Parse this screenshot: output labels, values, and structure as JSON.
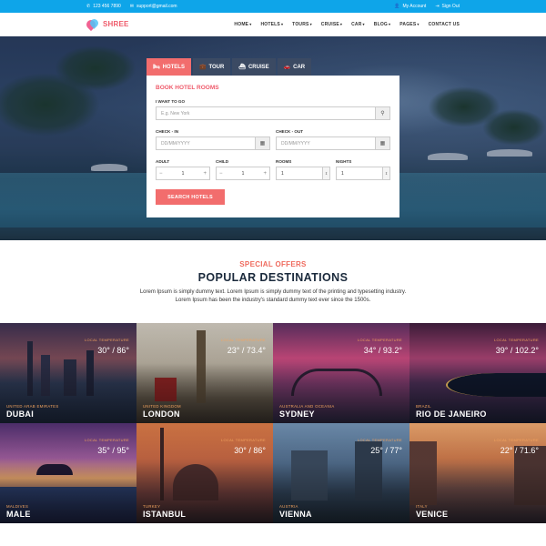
{
  "topbar": {
    "phone": "123 456 7890",
    "email": "support@gmail.com",
    "account": "My Account",
    "signout": "Sign Out"
  },
  "header": {
    "logo": "SHREE",
    "nav": [
      {
        "label": "HOME",
        "has_caret": true
      },
      {
        "label": "HOTELS",
        "has_caret": true
      },
      {
        "label": "TOURS",
        "has_caret": true
      },
      {
        "label": "CRUISE",
        "has_caret": true
      },
      {
        "label": "CAR",
        "has_caret": true
      },
      {
        "label": "BLOG",
        "has_caret": true
      },
      {
        "label": "PAGES",
        "has_caret": true
      },
      {
        "label": "CONTACT US",
        "has_caret": false
      }
    ]
  },
  "search": {
    "tabs": [
      {
        "label": "HOTELS",
        "icon": "bed-icon",
        "active": true
      },
      {
        "label": "TOUR",
        "icon": "suitcase-icon",
        "active": false
      },
      {
        "label": "CRUISE",
        "icon": "ship-icon",
        "active": false
      },
      {
        "label": "CAR",
        "icon": "car-icon",
        "active": false
      }
    ],
    "title": "BOOK HOTEL ROOMS",
    "destination_label": "I WANT TO GO",
    "destination_placeholder": "E.g. New York",
    "checkin_label": "CHECK - IN",
    "checkin_placeholder": "DD/MM/YYYY",
    "checkout_label": "CHECK - OUT",
    "checkout_placeholder": "DD/MM/YYYY",
    "adult_label": "ADULT",
    "adult_value": "1",
    "child_label": "CHILD",
    "child_value": "1",
    "rooms_label": "ROOMS",
    "rooms_value": "1",
    "nights_label": "NIGHTS",
    "nights_value": "1",
    "button": "SEARCH HOTELS"
  },
  "section": {
    "subtitle": "SPECIAL OFFERS",
    "title": "POPULAR DESTINATIONS",
    "desc_line1": "Lorem Ipsum is simply dummy text. Lorem Ipsum is simply dummy text of the printing and typesetting industry.",
    "desc_line2": "Lorem Ipsum has been the industry's standard dummy text ever since the 1500s."
  },
  "destinations": [
    {
      "country": "UNITED ARAB EMIRATES",
      "city": "DUBAI",
      "temp_label": "LOCAL TEMPERATURE",
      "temp": "30° / 86°"
    },
    {
      "country": "UNITED KINGDOM",
      "city": "LONDON",
      "temp_label": "LOCAL TEMPERATURE",
      "temp": "23° / 73.4°"
    },
    {
      "country": "AUSTRALIA AND OCEANIA",
      "city": "SYDNEY",
      "temp_label": "LOCAL TEMPERATURE",
      "temp": "34° / 93.2°"
    },
    {
      "country": "BRAZIL",
      "city": "RIO DE JANEIRO",
      "temp_label": "LOCAL TEMPERATURE",
      "temp": "39° / 102.2°"
    },
    {
      "country": "MALDIVES",
      "city": "MALE",
      "temp_label": "LOCAL TEMPERATURE",
      "temp": "35° / 95°"
    },
    {
      "country": "TURKEY",
      "city": "ISTANBUL",
      "temp_label": "LOCAL TEMPERATURE",
      "temp": "30° / 86°"
    },
    {
      "country": "AUSTRIA",
      "city": "VIENNA",
      "temp_label": "LOCAL TEMPERATURE",
      "temp": "25° / 77°"
    },
    {
      "country": "ITALY",
      "city": "VENICE",
      "temp_label": "LOCAL TEMPERATURE",
      "temp": "22° / 71.6°"
    }
  ],
  "colors": {
    "accent": "#f26d6d",
    "topbar": "#0ea5e9",
    "tab_inactive": "#3b4a63",
    "title_dark": "#1b2a3c",
    "temp_orange": "#f3a45f"
  }
}
